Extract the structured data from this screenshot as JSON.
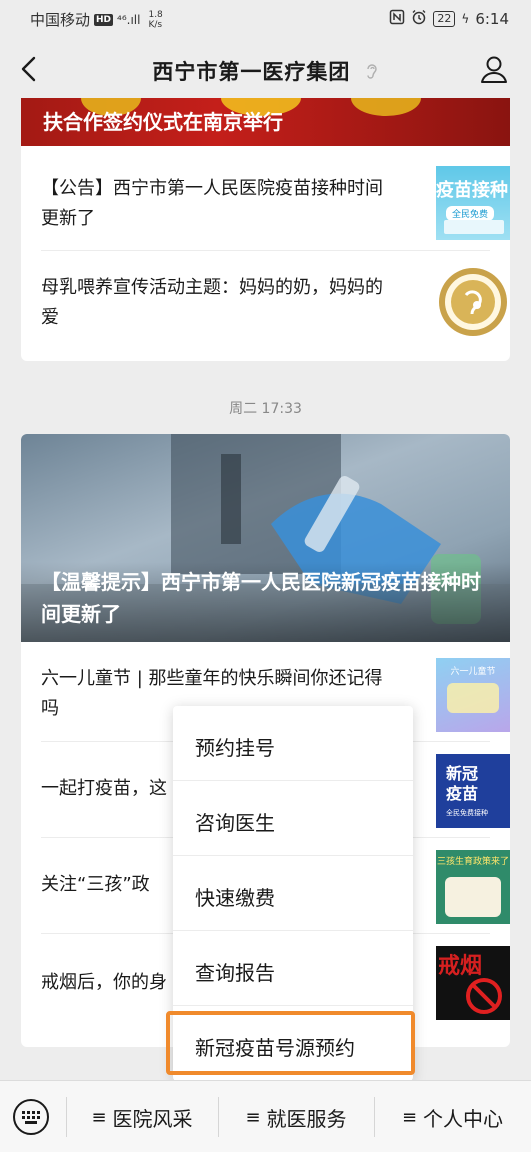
{
  "status": {
    "carrier": "中国移动",
    "hd": "HD",
    "signal": "⁴⁶.ıll",
    "speed_value": "1.8",
    "speed_unit": "K/s",
    "battery": "22",
    "time": "6:14"
  },
  "nav": {
    "title": "西宁市第一医疗集团"
  },
  "card1": {
    "banner_title": "扶合作签约仪式在南京举行",
    "items": [
      {
        "text": "【公告】西宁市第一人民医院疫苗接种时间更新了",
        "thumb_text": "疫苗接种",
        "thumb_sub": "全民免费"
      },
      {
        "text": "母乳喂养宣传活动主题：妈妈的奶，妈妈的爱"
      }
    ]
  },
  "timestamp": "周二 17:33",
  "card2": {
    "hero_title": "【温馨提示】西宁市第一人民医院新冠疫苗接种时间更新了",
    "items": [
      {
        "text": "六一儿童节 | 那些童年的快乐瞬间你还记得吗",
        "thumb_text": "六一儿童节"
      },
      {
        "text": "一起打疫苗，这",
        "thumb_text": "新冠疫苗",
        "thumb_sub": "全民免费接种"
      },
      {
        "text": "关注“三孩”政",
        "thumb_text": "三孩生育政策来了"
      },
      {
        "text": "戒烟后，你的身",
        "thumb_text": "戒烟"
      }
    ]
  },
  "popup_menu": {
    "items": [
      "预约挂号",
      "咨询医生",
      "快速缴费",
      "查询报告",
      "新冠疫苗号源预约"
    ]
  },
  "bottom_menu": {
    "items": [
      "医院风采",
      "就医服务",
      "个人中心"
    ]
  },
  "colors": {
    "highlight": "#f08a2c",
    "banner_red": "#c41f1a"
  }
}
